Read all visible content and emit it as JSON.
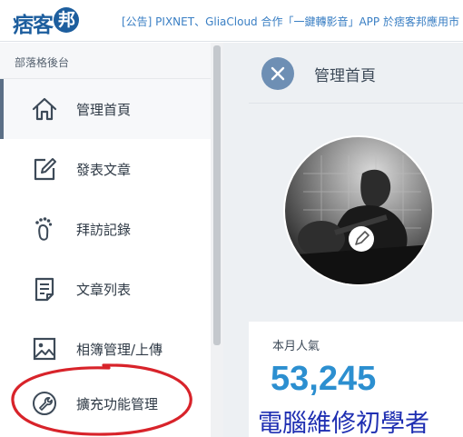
{
  "header": {
    "logo_text": "痞客",
    "logo_badge": "邦",
    "announcement": "[公告] PIXNET、GliaCloud 合作「一鍵轉影音」APP 於痞客邦應用市集上線"
  },
  "sidebar": {
    "title": "部落格後台",
    "items": [
      {
        "label": "管理首頁",
        "icon": "home-icon",
        "active": true
      },
      {
        "label": "發表文章",
        "icon": "edit-icon",
        "active": false
      },
      {
        "label": "拜訪記錄",
        "icon": "footprint-icon",
        "active": false
      },
      {
        "label": "文章列表",
        "icon": "document-list-icon",
        "active": false
      },
      {
        "label": "相簿管理/上傳",
        "icon": "photo-icon",
        "active": false
      },
      {
        "label": "擴充功能管理",
        "icon": "wrench-icon",
        "active": false
      }
    ]
  },
  "main": {
    "title": "管理首頁",
    "stat_label": "本月人氣",
    "stat_value": "53,245"
  },
  "watermark": "電腦維修初學者",
  "colors": {
    "brand": "#1d5e9e",
    "link": "#3a7fc4",
    "stat": "#2c8fd0",
    "close_button": "#6e8fb4",
    "annotation": "#d8232a",
    "watermark": "#1f2fb2"
  }
}
